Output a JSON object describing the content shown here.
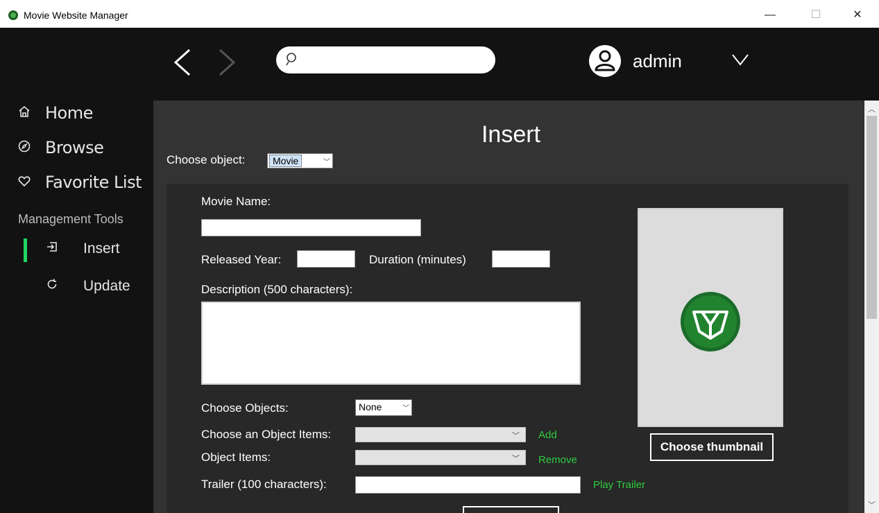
{
  "window": {
    "title": "Movie Website Manager",
    "minimize": "—",
    "maximize": "☐",
    "close": "✕"
  },
  "sidebar": {
    "nav": [
      {
        "label": "Home",
        "icon": "home-icon"
      },
      {
        "label": "Browse",
        "icon": "compass-icon"
      },
      {
        "label": "Favorite List",
        "icon": "heart-icon"
      }
    ],
    "section_title": "Management Tools",
    "tools": [
      {
        "label": "Insert",
        "icon": "insert-icon",
        "active": true
      },
      {
        "label": "Update",
        "icon": "refresh-icon",
        "active": false
      }
    ],
    "active_color": "#1ed760"
  },
  "topbar": {
    "search": {
      "value": "",
      "placeholder": ""
    },
    "user": {
      "name": "admin"
    }
  },
  "main": {
    "title": "Insert",
    "choose_object_label": "Choose object:",
    "choose_object_value": "Movie",
    "form": {
      "movie_name_label": "Movie Name:",
      "movie_name_value": "",
      "released_year_label": "Released Year:",
      "released_year_value": "",
      "duration_label": "Duration (minutes)",
      "duration_value": "",
      "description_label": "Description (500 characters):",
      "description_value": "",
      "choose_objects_label": "Choose Objects:",
      "choose_objects_value": "None",
      "choose_object_items_label": "Choose an Object Items:",
      "choose_object_items_value": "",
      "add_label": "Add",
      "object_items_label": "Object Items:",
      "object_items_value": "",
      "remove_label": "Remove",
      "trailer_label": "Trailer (100 characters):",
      "trailer_value": "",
      "play_trailer_label": "Play Trailer"
    },
    "thumbnail": {
      "button_label": "Choose thumbnail",
      "logo_color": "#1b6b2a"
    }
  },
  "colors": {
    "sidebar_bg": "#121212",
    "main_bg": "#333333",
    "panel_bg": "#282828",
    "accent_green": "#2ecc40"
  }
}
